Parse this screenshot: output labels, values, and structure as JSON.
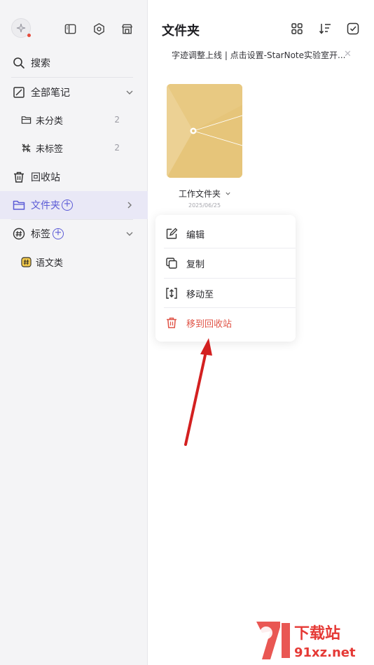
{
  "sidebar": {
    "search_label": "搜索",
    "all_notes_label": "全部笔记",
    "uncategorized": {
      "label": "未分类",
      "count": "2"
    },
    "untagged": {
      "label": "未标签",
      "count": "2"
    },
    "trash_label": "回收站",
    "folders_label": "文件夹",
    "tags_label": "标签",
    "tag_items": [
      {
        "label": "语文类",
        "color": "#f2c94c"
      }
    ]
  },
  "main": {
    "title": "文件夹",
    "notice": "字迹调整上线 | 点击设置-StarNote实验室开...",
    "folder": {
      "name": "工作文件夹",
      "date": "2025/06/25",
      "color": "#e6c57a"
    }
  },
  "context_menu": {
    "edit": "编辑",
    "copy": "复制",
    "move": "移动至",
    "trash": "移到回收站"
  },
  "watermark": {
    "title": "下载站",
    "url": "91xz.net"
  },
  "colors": {
    "accent": "#5b5bd6",
    "danger": "#e05548",
    "arrow": "#d32020"
  }
}
